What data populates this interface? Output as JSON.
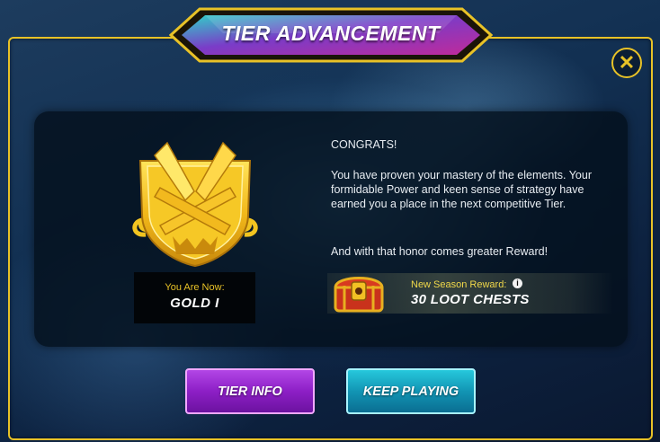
{
  "dialog": {
    "title": "TIER ADVANCEMENT",
    "close_symbol": "✕"
  },
  "tier": {
    "you_are_now_label": "You Are Now:",
    "name": "GOLD I",
    "badge_icon": "gold-tier-badge-icon"
  },
  "message": {
    "greeting": "CONGRATS!",
    "body": "You have proven your mastery of the elements. Your formidable Power and keen sense of strategy have earned you a place in the next competitive Tier.",
    "reward_line": "And with that honor comes greater Reward!"
  },
  "reward": {
    "label": "New Season Reward:",
    "info_symbol": "i",
    "value": "30 LOOT CHESTS",
    "icon": "loot-chest-icon"
  },
  "buttons": {
    "tier_info": "TIER INFO",
    "keep_playing": "KEEP PLAYING"
  },
  "colors": {
    "frame_gold": "#e8c227",
    "tier_info_purple": "#8d1fc6",
    "keep_playing_teal": "#1295b4"
  }
}
